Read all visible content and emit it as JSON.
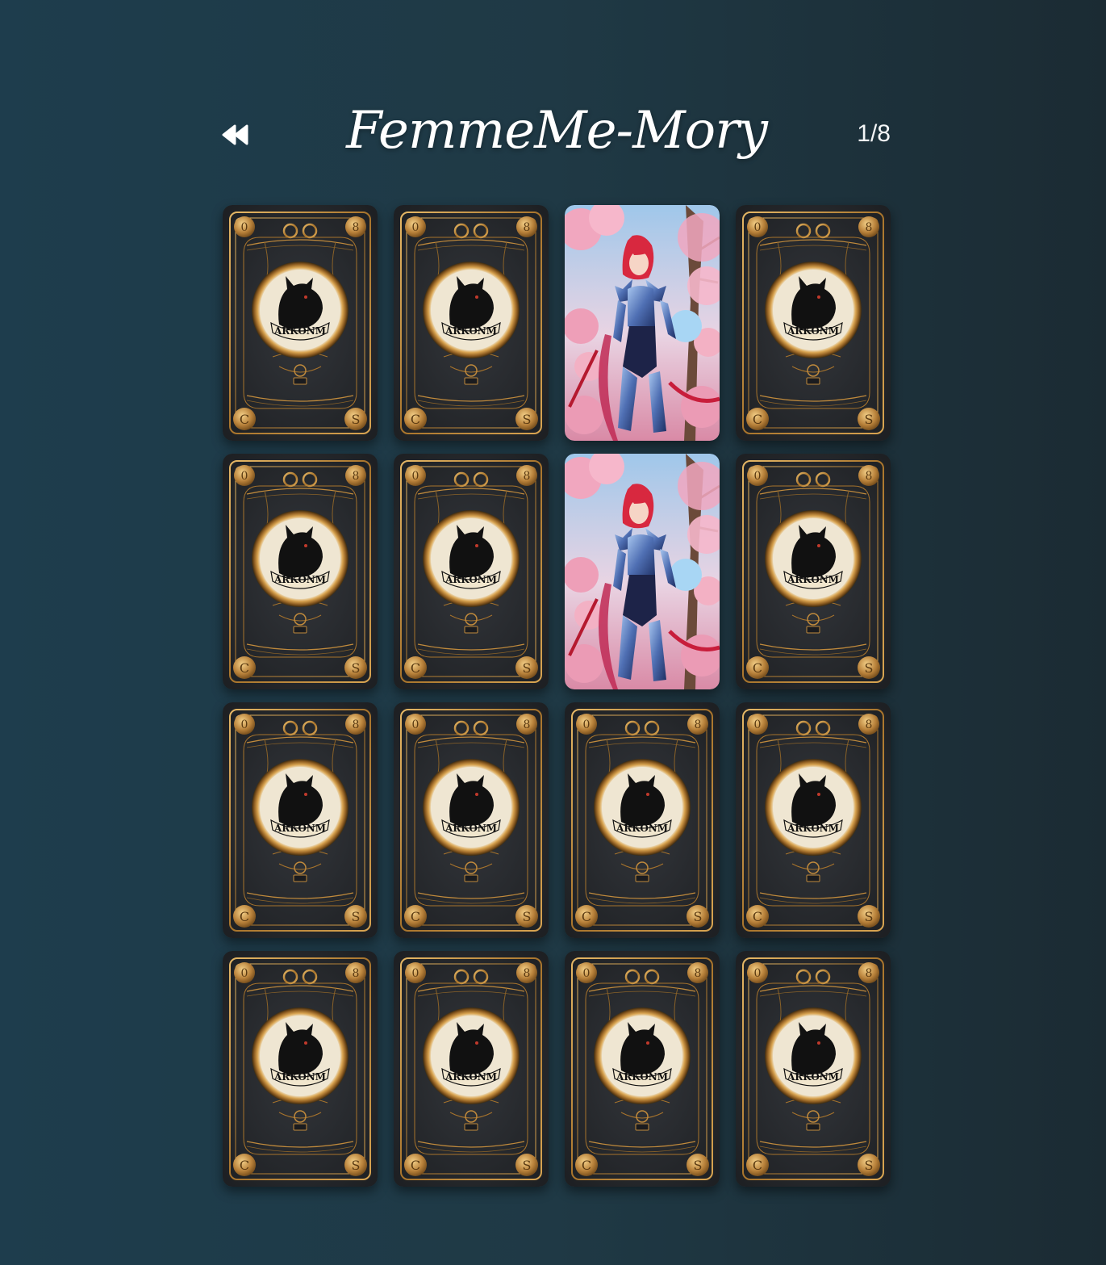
{
  "header": {
    "back_icon": "rewind-icon",
    "title": "FemmeMe-Mory",
    "progress": "1/8"
  },
  "colors": {
    "background": "#1f3945",
    "card_back_dark": "#26282c",
    "card_back_gold": "#c08a3c",
    "emblem_cream": "#efe6d2"
  },
  "cards": [
    {
      "state": "back",
      "logo_text": "ARKONM"
    },
    {
      "state": "back",
      "logo_text": "ARKONM"
    },
    {
      "state": "face",
      "character": "red-haired-armored-knight"
    },
    {
      "state": "back",
      "logo_text": "ARKONM"
    },
    {
      "state": "back",
      "logo_text": "ARKONM"
    },
    {
      "state": "back",
      "logo_text": "ARKONM"
    },
    {
      "state": "face",
      "character": "red-haired-armored-knight"
    },
    {
      "state": "back",
      "logo_text": "ARKONM"
    },
    {
      "state": "back",
      "logo_text": "ARKONM"
    },
    {
      "state": "back",
      "logo_text": "ARKONM"
    },
    {
      "state": "back",
      "logo_text": "ARKONM"
    },
    {
      "state": "back",
      "logo_text": "ARKONM"
    },
    {
      "state": "back",
      "logo_text": "ARKONM"
    },
    {
      "state": "back",
      "logo_text": "ARKONM"
    },
    {
      "state": "back",
      "logo_text": "ARKONM"
    },
    {
      "state": "back",
      "logo_text": "ARKONM"
    }
  ]
}
